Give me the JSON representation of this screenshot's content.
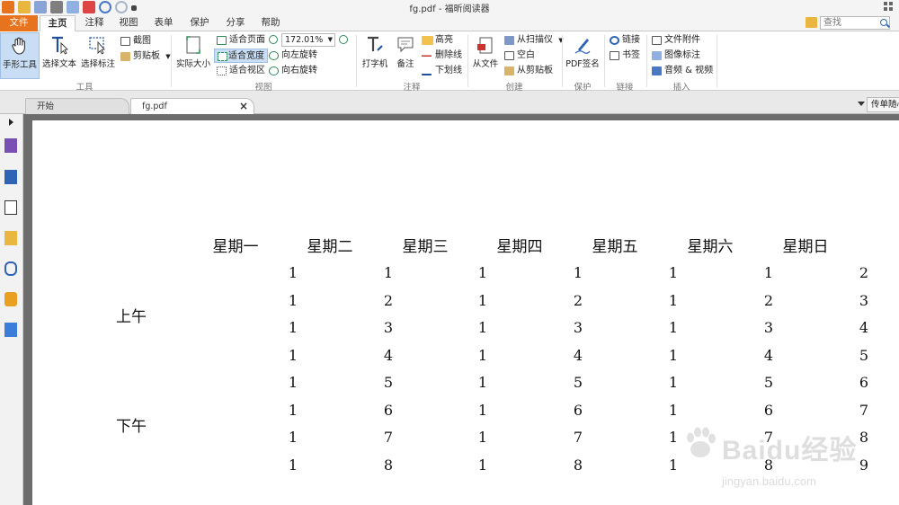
{
  "titlebar": {
    "title": "fg.pdf - 福昕阅读器"
  },
  "ribbon_tabs": [
    "文件",
    "主页",
    "注释",
    "视图",
    "表单",
    "保护",
    "分享",
    "帮助"
  ],
  "search": {
    "placeholder": "查找"
  },
  "ribbon": {
    "tools": {
      "hand": "手形工具",
      "select_text": "选择文本",
      "select_annot": "选择标注",
      "snapshot": "截图",
      "clipboard": "剪贴板",
      "group": "工具"
    },
    "view": {
      "actual_size": "实际大小",
      "fit_page": "适合页面",
      "fit_width": "适合宽度",
      "fit_visible": "适合视区",
      "zoom": "172.01%",
      "rotate_left": "向左旋转",
      "rotate_right": "向右旋转",
      "group": "视图"
    },
    "comment": {
      "typewriter": "打字机",
      "note": "备注",
      "highlight": "高亮",
      "strikeout": "删除线",
      "underline": "下划线",
      "group": "注释"
    },
    "create": {
      "from_file": "从文件",
      "from_scanner": "从扫描仪",
      "blank": "空白",
      "from_clipboard": "从剪贴板",
      "group": "创建"
    },
    "protect": {
      "sign": "PDF签名",
      "group": "保护"
    },
    "links": {
      "link": "链接",
      "bookmark": "书签",
      "group": "链接"
    },
    "insert": {
      "file_attachment": "文件附件",
      "image_annot": "图像标注",
      "audio_video": "音频 & 视频",
      "group": "插入"
    }
  },
  "doc_tabs": {
    "start": "开始",
    "file": "fg.pdf",
    "close": "×",
    "side_panel": "传单随心"
  },
  "table": {
    "headers": [
      "星期一",
      "星期二",
      "星期三",
      "星期四",
      "星期五",
      "星期六",
      "星期日"
    ],
    "section_labels": [
      "上午",
      "下午"
    ],
    "rows": [
      [
        "1",
        "1",
        "1",
        "1",
        "1",
        "1",
        "2"
      ],
      [
        "1",
        "2",
        "1",
        "2",
        "1",
        "2",
        "3"
      ],
      [
        "1",
        "3",
        "1",
        "3",
        "1",
        "3",
        "4"
      ],
      [
        "1",
        "4",
        "1",
        "4",
        "1",
        "4",
        "5"
      ],
      [
        "1",
        "5",
        "1",
        "5",
        "1",
        "5",
        "6"
      ],
      [
        "1",
        "6",
        "1",
        "6",
        "1",
        "6",
        "7"
      ],
      [
        "1",
        "7",
        "1",
        "7",
        "1",
        "7",
        "8"
      ],
      [
        "1",
        "8",
        "1",
        "8",
        "1",
        "8",
        "9"
      ]
    ]
  },
  "watermark": {
    "brand": "Baidu经验",
    "url": "jingyan.baidu.com"
  },
  "colors": {
    "accent": "#e8731f",
    "link_blue": "#2f63b4",
    "doc_background": "#6d6d6d"
  }
}
